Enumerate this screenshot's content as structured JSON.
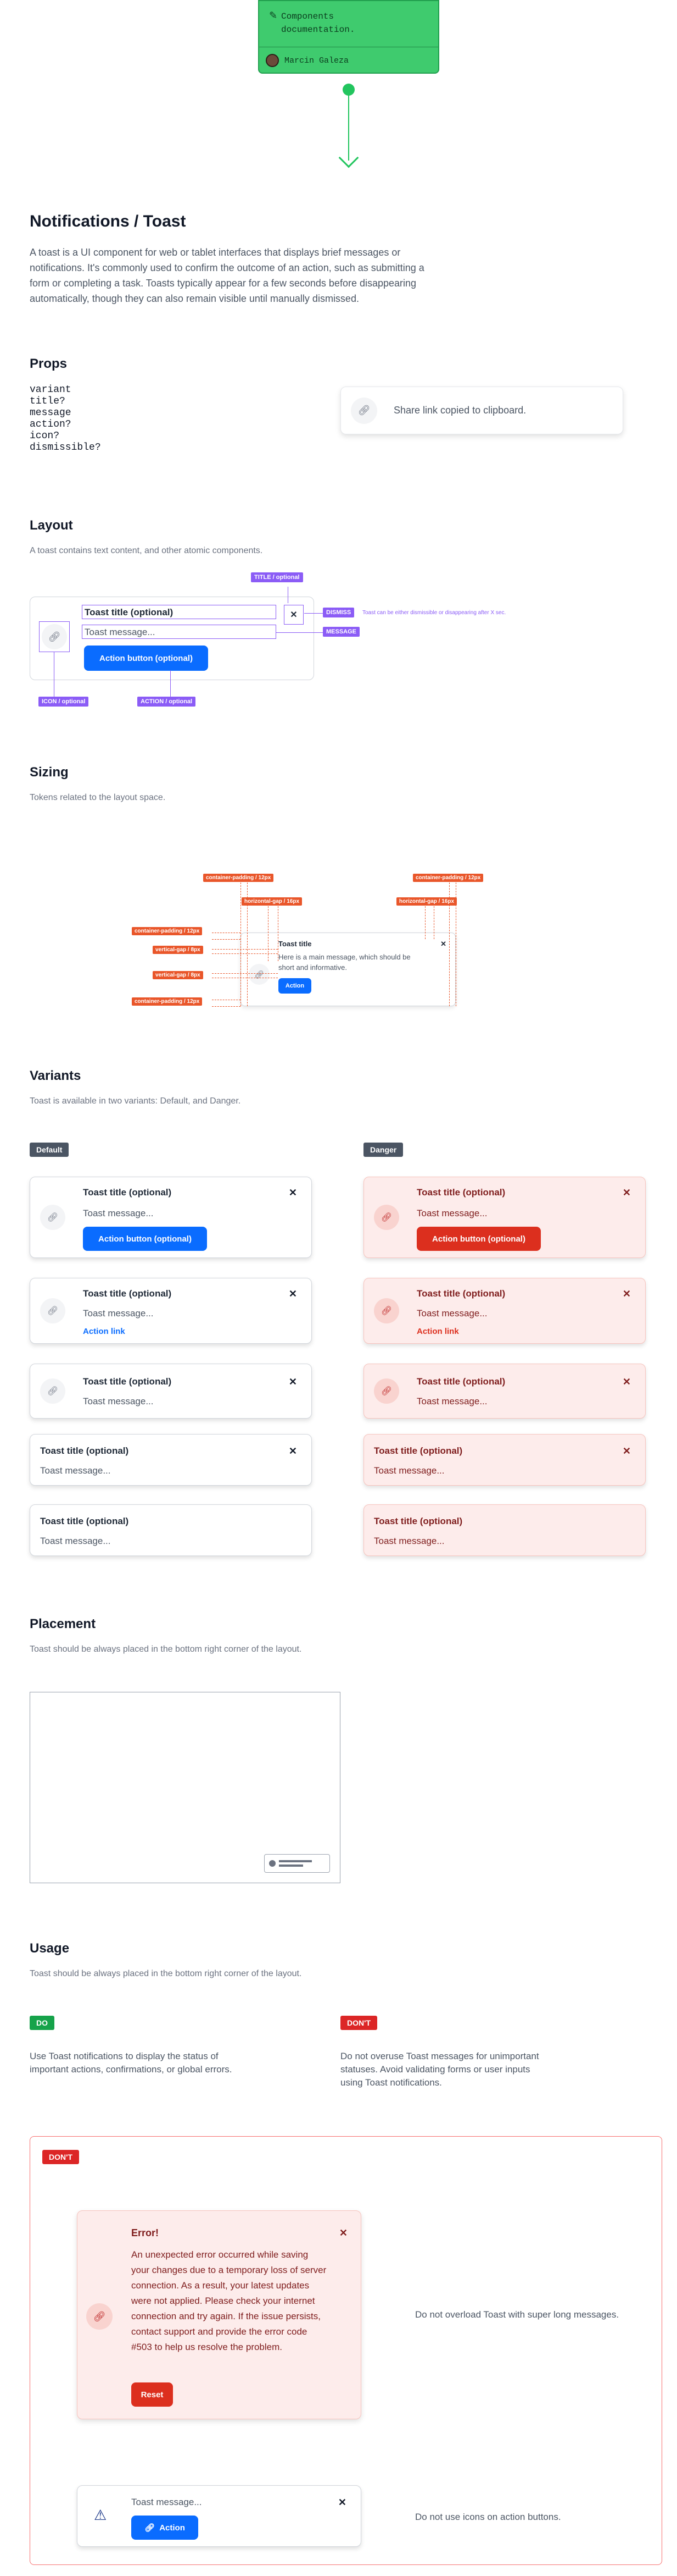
{
  "doc_card": {
    "title": "Components documentation.",
    "author": "Marcin Galeza"
  },
  "page": {
    "title": "Notifications / Toast",
    "intro": "A toast is a UI component for web or tablet interfaces that displays brief messages or notifications. It's commonly used to confirm the outcome of an action, such as submitting a form or completing a task. Toasts typically appear for a few seconds before disappearing automatically, though they can also remain visible until manually dismissed."
  },
  "props": {
    "heading": "Props",
    "list": [
      "variant",
      "title?",
      "message",
      "action?",
      "icon?",
      "dismissible?"
    ],
    "example_message": "Share link copied to clipboard."
  },
  "layout": {
    "heading": "Layout",
    "subtitle": "A toast contains text content, and other atomic components.",
    "title_text": "Toast title (optional)",
    "message_text": "Toast message...",
    "button_text": "Action button (optional)",
    "tags": {
      "title": "TITLE / optional",
      "dismiss": "DISMISS",
      "message": "MESSAGE",
      "icon": "ICON / optional",
      "action": "ACTION / optional"
    },
    "dismiss_note": "Toast can be either dismissible or disappearing after X sec."
  },
  "sizing": {
    "heading": "Sizing",
    "subtitle": "Tokens related to the layout space.",
    "toast_title": "Toast title",
    "toast_message": "Here is a main message, which should be short and informative.",
    "toast_action": "Action",
    "tokens": {
      "container_padding": "container-padding / 12px",
      "horizontal_gap": "horizontal-gap / 16px",
      "vertical_gap": "vertical-gap / 8px"
    }
  },
  "variants": {
    "heading": "Variants",
    "subtitle": "Toast is available in two variants: Default, and Danger.",
    "default_label": "Default",
    "danger_label": "Danger",
    "title": "Toast title (optional)",
    "message": "Toast message...",
    "button": "Action button (optional)",
    "link": "Action link"
  },
  "placement": {
    "heading": "Placement",
    "subtitle": "Toast should be always placed in the bottom right corner of the layout."
  },
  "usage": {
    "heading": "Usage",
    "subtitle": "Toast should be always placed in the bottom right corner of the layout.",
    "do_label": "DO",
    "dont_label": "DON'T",
    "do_text": "Use Toast notifications to display the status of important actions, confirmations, or global errors.",
    "dont_text": "Do not overuse Toast messages for unimportant statuses. Avoid validating forms or user inputs using Toast notifications.",
    "example_dont_label": "DON'T",
    "error_title": "Error!",
    "error_message": "An unexpected error occurred while saving your changes due to a temporary loss of server connection. As a result, your latest updates were not applied. Please check your internet connection and try again. If the issue persists, contact support and provide the error code #503 to help us resolve the problem.",
    "reset_label": "Reset",
    "note_long": "Do not overload Toast with super long messages.",
    "icon_toast_message": "Toast message...",
    "icon_toast_action": "Action",
    "note_icons": "Do not use icons on action buttons."
  },
  "icons": [
    "pencil-icon",
    "link-icon",
    "close-icon",
    "warning-icon"
  ]
}
